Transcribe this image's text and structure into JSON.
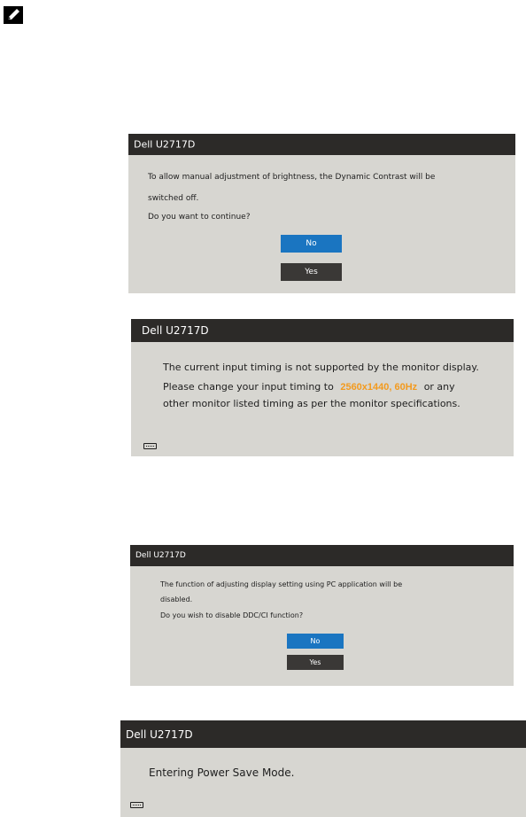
{
  "note_icon": "pencil-note-icon",
  "colors": {
    "titlebar_bg": "#2c2a28",
    "dialog_bg": "#d7d6d1",
    "button_no": "#1a75c1",
    "button_yes": "#3a3836",
    "highlight": "#f39a1e"
  },
  "dialog1": {
    "title": "Dell U2717D",
    "line1": "To allow manual adjustment of brightness, the Dynamic Contrast will be",
    "line2": "switched off.",
    "line3": "Do you want to continue?",
    "no_label": "No",
    "yes_label": "Yes"
  },
  "dialog2": {
    "title": "Dell U2717D",
    "line1": "The current input timing is not supported by the monitor display.",
    "line2_prefix": "Please change your input timing to",
    "line2_highlight": "2560x1440, 60Hz",
    "line2_suffix": "or any",
    "line3": "other monitor listed timing as per the monitor specifications.",
    "icon": "display-port-icon"
  },
  "dialog3": {
    "title": "Dell U2717D",
    "line1": "The function of adjusting display setting using PC application will be",
    "line2": "disabled.",
    "line3": "Do you wish to disable DDC/CI function?",
    "no_label": "No",
    "yes_label": "Yes"
  },
  "dialog4": {
    "title": "Dell U2717D",
    "message": "Entering Power Save Mode.",
    "icon": "display-port-icon"
  }
}
